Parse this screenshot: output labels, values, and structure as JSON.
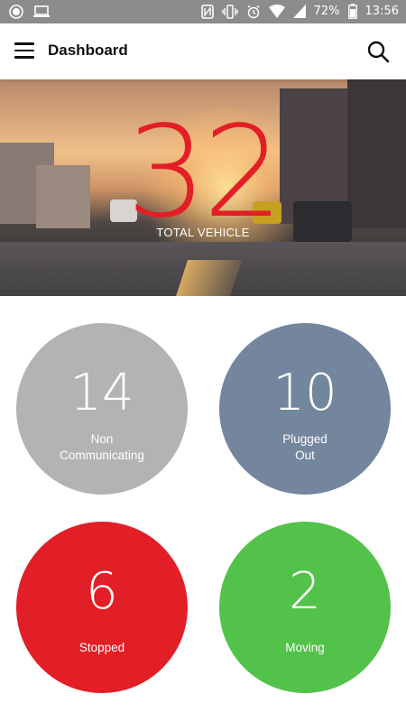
{
  "status_bar": {
    "battery": "72%",
    "time": "13:56",
    "icons": [
      "record-icon",
      "laptop-icon",
      "nfc-icon",
      "vibrate-icon",
      "alarm-icon",
      "wifi-icon",
      "signal-icon",
      "battery-icon"
    ]
  },
  "app_bar": {
    "title": "Dashboard",
    "menu_icon": "menu-icon",
    "search_icon": "search-icon"
  },
  "hero": {
    "total": "32",
    "label": "TOTAL VEHICLE",
    "number_color": "#e21e26"
  },
  "stats": [
    {
      "value": "14",
      "label": "Non\nCommunicating",
      "color": "#b3b3b3"
    },
    {
      "value": "10",
      "label": "Plugged\nOut",
      "color": "#74859e"
    },
    {
      "value": "6",
      "label": "Stopped",
      "color": "#e21e26"
    },
    {
      "value": "2",
      "label": "Moving",
      "color": "#53c24a"
    }
  ]
}
